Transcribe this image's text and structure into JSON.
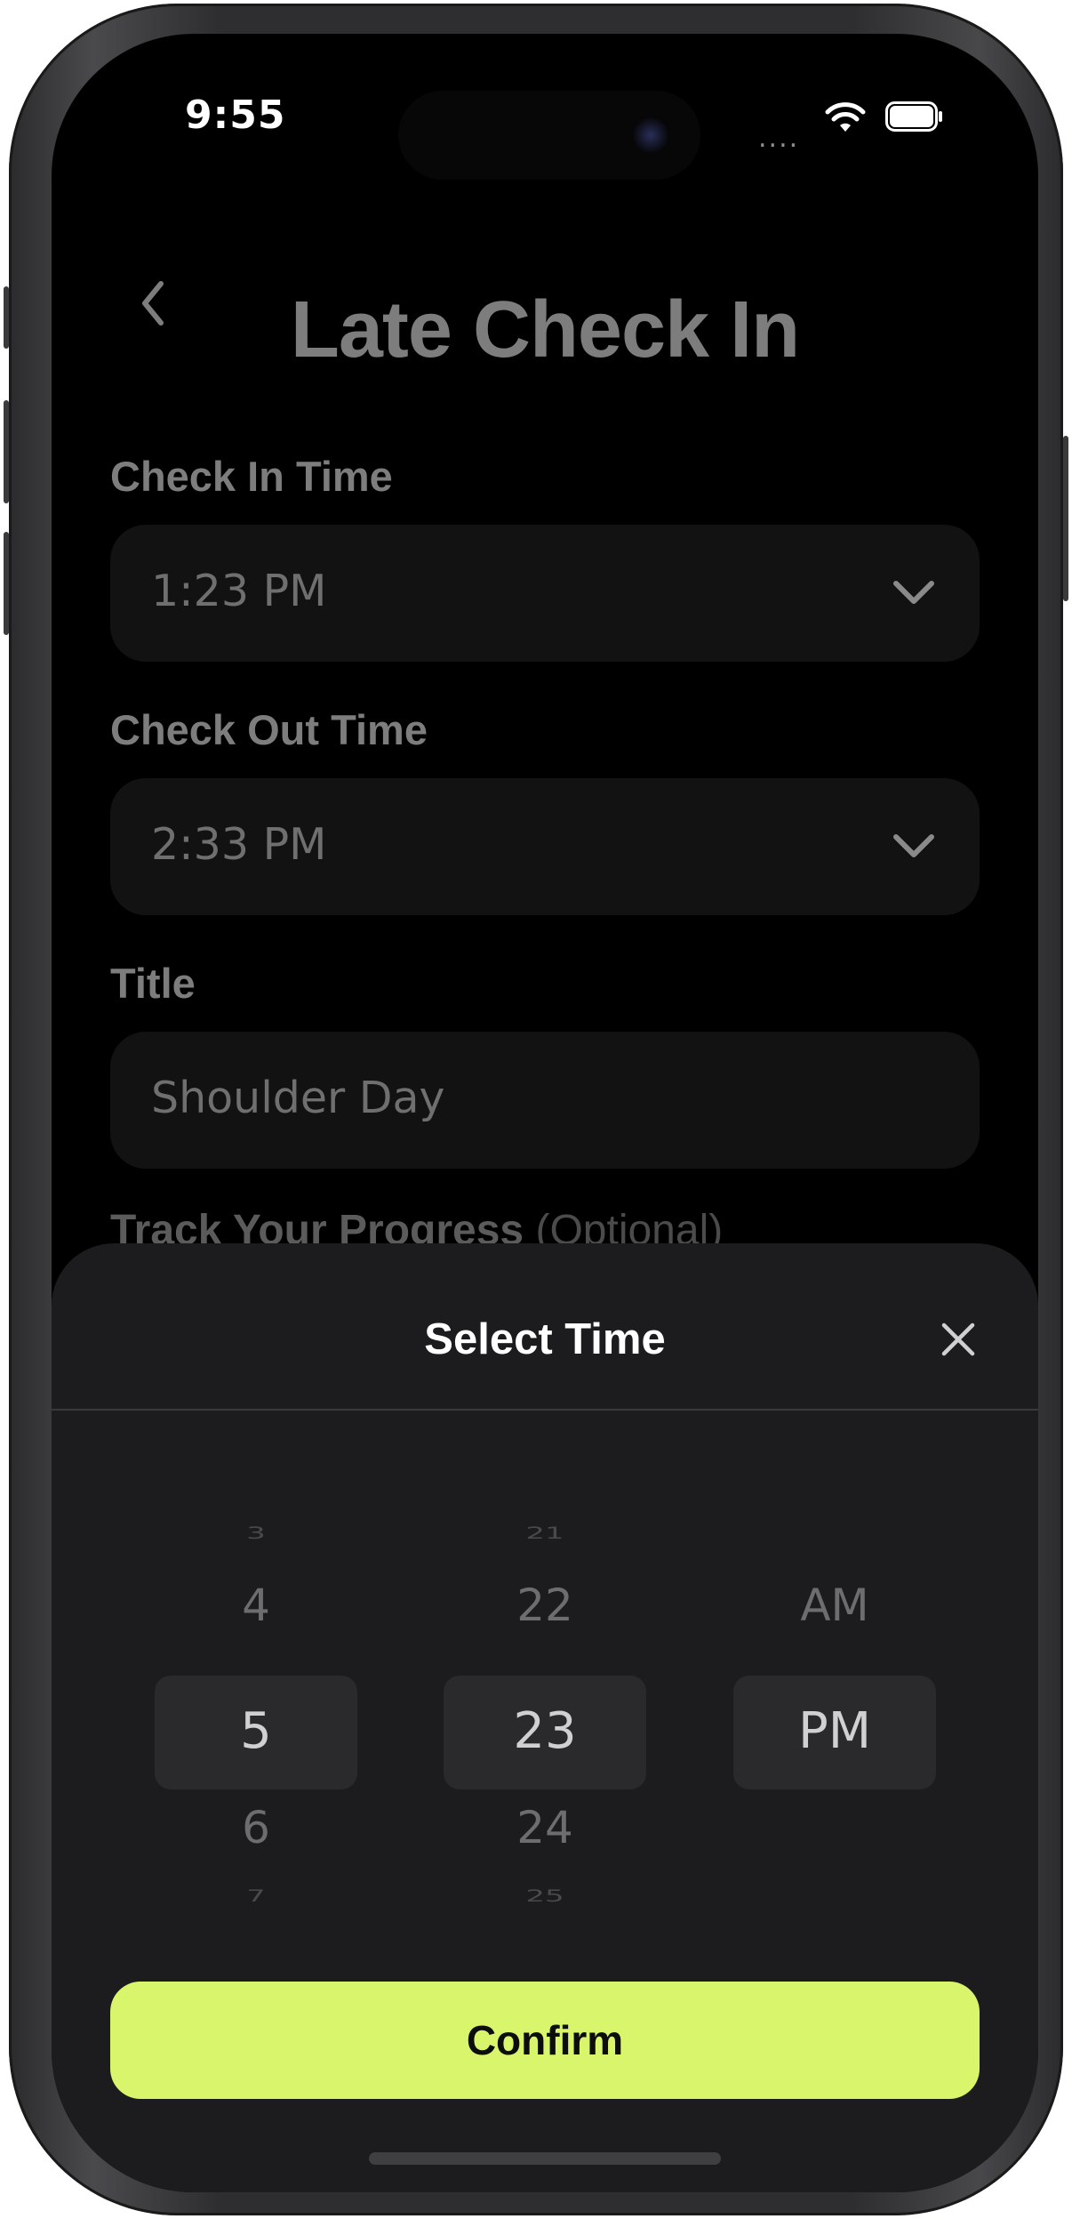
{
  "status_bar": {
    "time": "9:55",
    "signal": "....",
    "icons": [
      "wifi-icon",
      "battery-icon"
    ]
  },
  "header": {
    "back_icon": "chevron-left-icon",
    "title": "Late Check In"
  },
  "form": {
    "check_in": {
      "label": "Check In Time",
      "value": "1:23 PM"
    },
    "check_out": {
      "label": "Check Out Time",
      "value": "2:33 PM"
    },
    "title_field": {
      "label": "Title",
      "value": "Shoulder Day"
    },
    "track": {
      "label": "Track Your Progress",
      "optional": "(Optional)"
    }
  },
  "sheet": {
    "title": "Select Time",
    "close_icon": "close-icon",
    "hours": {
      "items": [
        "3",
        "4",
        "5",
        "6",
        "7"
      ],
      "selected": "5"
    },
    "minutes": {
      "items": [
        "21",
        "22",
        "23",
        "24",
        "25"
      ],
      "selected": "23"
    },
    "period": {
      "items": [
        "AM",
        "PM"
      ],
      "selected": "PM"
    },
    "confirm_label": "Confirm"
  },
  "colors": {
    "accent": "#d9f56b",
    "background": "#000000",
    "sheet": "#1c1c1e",
    "field": "#121212"
  }
}
